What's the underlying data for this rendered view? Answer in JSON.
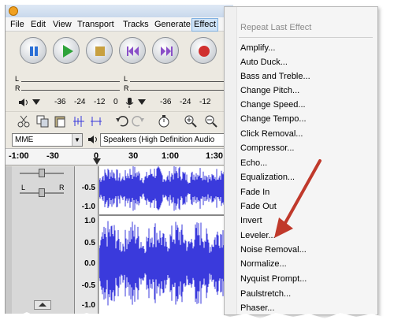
{
  "menubar": {
    "items": [
      "File",
      "Edit",
      "View",
      "Transport",
      "Tracks",
      "Generate",
      "Effect"
    ]
  },
  "meters": {
    "l": "L",
    "r": "R",
    "ticks": [
      "-36",
      "-24",
      "-12",
      "0"
    ],
    "ticks2": [
      "-36",
      "-24",
      "-12"
    ]
  },
  "devices": {
    "host": "MME",
    "output": "Speakers (High Definition Audio"
  },
  "ruler": {
    "ticks": [
      "-1:00",
      "-30",
      "0",
      "30",
      "1:00",
      "1:30"
    ]
  },
  "track": {
    "pan_l": "L",
    "pan_r": "R",
    "y_ticks": [
      "-0.5",
      "-1.0",
      "1.0",
      "0.5",
      "0.0",
      "-0.5",
      "-1.0"
    ]
  },
  "effect_menu": {
    "header": "Repeat Last Effect",
    "items": [
      "Amplify...",
      "Auto Duck...",
      "Bass and Treble...",
      "Change Pitch...",
      "Change Speed...",
      "Change Tempo...",
      "Click Removal...",
      "Compressor...",
      "Echo...",
      "Equalization...",
      "Fade In",
      "Fade Out",
      "Invert",
      "Leveler...",
      "Noise Removal...",
      "Normalize...",
      "Nyquist Prompt...",
      "Paulstretch...",
      "Phaser..."
    ]
  },
  "colors": {
    "wave": "#3a3adc",
    "arrow": "#c0392b",
    "menu_active": "#cfe3f7"
  }
}
